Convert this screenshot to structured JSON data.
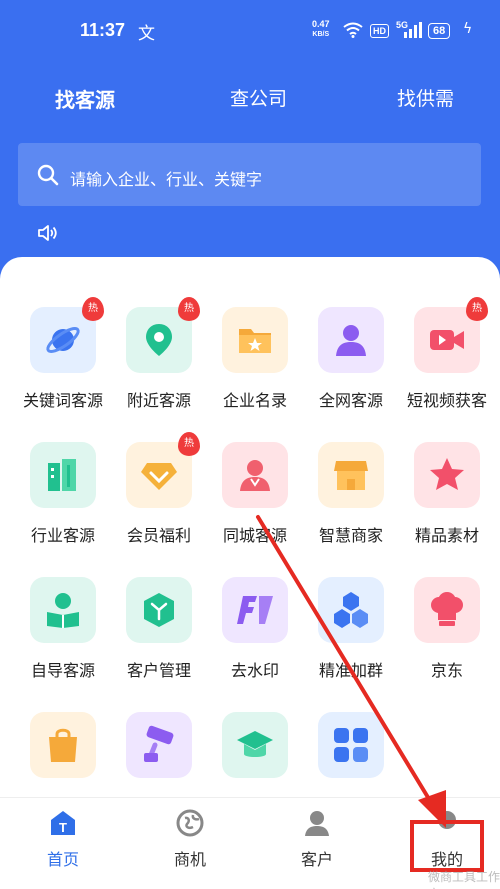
{
  "status": {
    "time": "11:37",
    "app_glyph": "文",
    "speed_top": "0.47",
    "speed_unit": "KB/S",
    "hd": "HD",
    "net": "5G",
    "battery": "68"
  },
  "tabs": [
    {
      "label": "找客源",
      "active": true
    },
    {
      "label": "查公司",
      "active": false
    },
    {
      "label": "找供需",
      "active": false
    }
  ],
  "search": {
    "placeholder": "请输入企业、行业、关键字"
  },
  "hot_badge": "热",
  "grid": [
    {
      "label": "关键词客源",
      "icon": "planet-icon",
      "hot": true
    },
    {
      "label": "附近客源",
      "icon": "location-pin-icon",
      "hot": true
    },
    {
      "label": "企业名录",
      "icon": "folder-star-icon",
      "hot": false
    },
    {
      "label": "全网客源",
      "icon": "person-icon",
      "hot": false
    },
    {
      "label": "短视频获客",
      "icon": "video-camera-icon",
      "hot": true
    },
    {
      "label": "行业客源",
      "icon": "buildings-icon",
      "hot": false
    },
    {
      "label": "会员福利",
      "icon": "vip-diamond-icon",
      "hot": true
    },
    {
      "label": "同城客源",
      "icon": "user-badge-icon",
      "hot": false
    },
    {
      "label": "智慧商家",
      "icon": "shop-icon",
      "hot": false
    },
    {
      "label": "精品素材",
      "icon": "star-icon",
      "hot": false
    },
    {
      "label": "自导客源",
      "icon": "user-book-icon",
      "hot": false
    },
    {
      "label": "客户管理",
      "icon": "cube-icon",
      "hot": false
    },
    {
      "label": "去水印",
      "icon": "watermark-icon",
      "hot": false
    },
    {
      "label": "精准加群",
      "icon": "cubes-icon",
      "hot": false
    },
    {
      "label": "京东",
      "icon": "chef-hat-icon",
      "hot": false
    },
    {
      "label": "",
      "icon": "shopping-bag-icon",
      "hot": false
    },
    {
      "label": "",
      "icon": "paint-roller-icon",
      "hot": false
    },
    {
      "label": "",
      "icon": "graduation-cap-icon",
      "hot": false
    },
    {
      "label": "",
      "icon": "grid-apps-icon",
      "hot": false
    }
  ],
  "bottom_nav": [
    {
      "label": "首页",
      "icon": "home-icon",
      "active": true
    },
    {
      "label": "商机",
      "icon": "compass-icon",
      "active": false
    },
    {
      "label": "客户",
      "icon": "customer-icon",
      "active": false
    },
    {
      "label": "我的",
      "icon": "profile-icon",
      "active": false
    }
  ],
  "watermark": "微商工具工作室",
  "colors": {
    "brand": "#3a6ff0",
    "highlight": "#e52a22",
    "hot": "#ef3b3b"
  }
}
